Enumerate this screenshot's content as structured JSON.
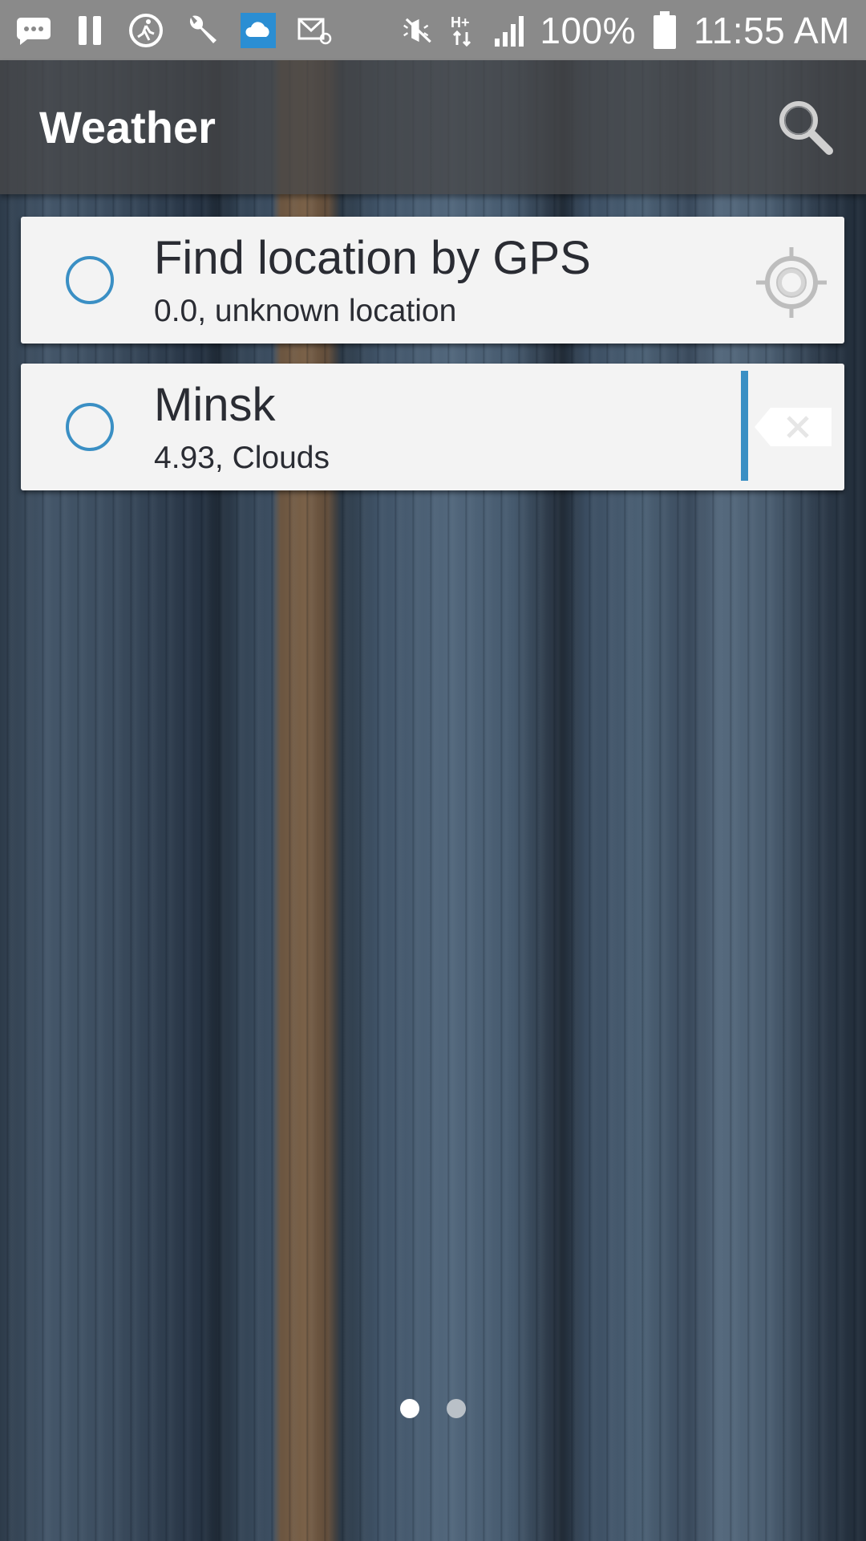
{
  "status_bar": {
    "icons_left": [
      "messaging-icon",
      "pause-icon",
      "fitness-icon",
      "wrench-icon",
      "weather-cloud-icon",
      "email-icon"
    ],
    "icons_right": [
      "mute-icon",
      "hplus-data-icon",
      "signal-icon",
      "battery-icon"
    ],
    "battery": "100%",
    "time": "11:55 AM"
  },
  "app_bar": {
    "title": "Weather",
    "search_icon": "search-icon"
  },
  "locations": [
    {
      "title": "Find location by GPS",
      "subtitle": "0.0, unknown location",
      "action_icon": "gps-target-icon",
      "selected": false
    },
    {
      "title": "Minsk",
      "subtitle": "4.93, Clouds",
      "action_icon": "delete-icon",
      "selected": false
    }
  ],
  "pager": {
    "pages": 2,
    "active_page": 1
  },
  "colors": {
    "accent": "#3a8fc4",
    "card_bg": "#f3f3f3",
    "status_bar": "#8a8a8a",
    "app_bar": "#464648"
  }
}
